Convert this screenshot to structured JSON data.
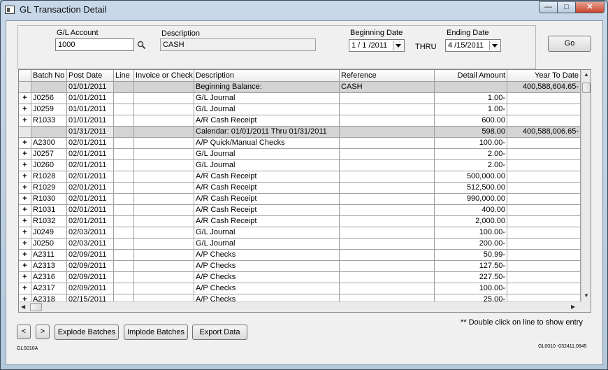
{
  "window": {
    "title": "GL Transaction Detail",
    "min_glyph": "—",
    "max_glyph": "□",
    "close_glyph": "✕"
  },
  "header": {
    "gl_account_label": "G/L Account",
    "gl_account_value": "1000",
    "description_label": "Description",
    "description_value": "CASH",
    "beginning_date_label": "Beginning Date",
    "beginning_date_value": "1 / 1 /2011",
    "thru_label": "THRU",
    "ending_date_label": "Ending Date",
    "ending_date_value": "4 /15/2011",
    "go_label": "Go"
  },
  "grid": {
    "columns": [
      "",
      "Batch No",
      "Post Date",
      "Line",
      "Invoice or Check",
      "Description",
      "Reference",
      "Detail Amount",
      "Year To Date"
    ],
    "rows": [
      {
        "expander": "",
        "batch": "",
        "post_date": "01/01/2011",
        "line": "",
        "invoice": "",
        "description": "Beginning Balance:",
        "reference": "CASH",
        "amount": "",
        "ytd": "400,588,604.65-",
        "shaded": true
      },
      {
        "expander": "+",
        "batch": "J0256",
        "post_date": "01/01/2011",
        "line": "",
        "invoice": "",
        "description": "G/L Journal",
        "reference": "",
        "amount": "1.00-",
        "ytd": "",
        "shaded": false
      },
      {
        "expander": "+",
        "batch": "J0259",
        "post_date": "01/01/2011",
        "line": "",
        "invoice": "",
        "description": "G/L Journal",
        "reference": "",
        "amount": "1.00-",
        "ytd": "",
        "shaded": false
      },
      {
        "expander": "+",
        "batch": "R1033",
        "post_date": "01/01/2011",
        "line": "",
        "invoice": "",
        "description": "A/R Cash Receipt",
        "reference": "",
        "amount": "600.00",
        "ytd": "",
        "shaded": false
      },
      {
        "expander": "",
        "batch": "",
        "post_date": "01/31/2011",
        "line": "",
        "invoice": "",
        "description": "Calendar: 01/01/2011  Thru  01/31/2011",
        "reference": "",
        "amount": "598.00",
        "ytd": "400,588,006.65-",
        "shaded": true
      },
      {
        "expander": "+",
        "batch": "A2300",
        "post_date": "02/01/2011",
        "line": "",
        "invoice": "",
        "description": "A/P Quick/Manual Checks",
        "reference": "",
        "amount": "100.00-",
        "ytd": "",
        "shaded": false
      },
      {
        "expander": "+",
        "batch": "J0257",
        "post_date": "02/01/2011",
        "line": "",
        "invoice": "",
        "description": "G/L Journal",
        "reference": "",
        "amount": "2.00-",
        "ytd": "",
        "shaded": false
      },
      {
        "expander": "+",
        "batch": "J0260",
        "post_date": "02/01/2011",
        "line": "",
        "invoice": "",
        "description": "G/L Journal",
        "reference": "",
        "amount": "2.00-",
        "ytd": "",
        "shaded": false
      },
      {
        "expander": "+",
        "batch": "R1028",
        "post_date": "02/01/2011",
        "line": "",
        "invoice": "",
        "description": "A/R Cash Receipt",
        "reference": "",
        "amount": "500,000.00",
        "ytd": "",
        "shaded": false
      },
      {
        "expander": "+",
        "batch": "R1029",
        "post_date": "02/01/2011",
        "line": "",
        "invoice": "",
        "description": "A/R Cash Receipt",
        "reference": "",
        "amount": "512,500.00",
        "ytd": "",
        "shaded": false
      },
      {
        "expander": "+",
        "batch": "R1030",
        "post_date": "02/01/2011",
        "line": "",
        "invoice": "",
        "description": "A/R Cash Receipt",
        "reference": "",
        "amount": "990,000.00",
        "ytd": "",
        "shaded": false
      },
      {
        "expander": "+",
        "batch": "R1031",
        "post_date": "02/01/2011",
        "line": "",
        "invoice": "",
        "description": "A/R Cash Receipt",
        "reference": "",
        "amount": "400.00",
        "ytd": "",
        "shaded": false
      },
      {
        "expander": "+",
        "batch": "R1032",
        "post_date": "02/01/2011",
        "line": "",
        "invoice": "",
        "description": "A/R Cash Receipt",
        "reference": "",
        "amount": "2,000.00",
        "ytd": "",
        "shaded": false
      },
      {
        "expander": "+",
        "batch": "J0249",
        "post_date": "02/03/2011",
        "line": "",
        "invoice": "",
        "description": "G/L Journal",
        "reference": "",
        "amount": "100.00-",
        "ytd": "",
        "shaded": false
      },
      {
        "expander": "+",
        "batch": "J0250",
        "post_date": "02/03/2011",
        "line": "",
        "invoice": "",
        "description": "G/L Journal",
        "reference": "",
        "amount": "200.00-",
        "ytd": "",
        "shaded": false
      },
      {
        "expander": "+",
        "batch": "A2311",
        "post_date": "02/09/2011",
        "line": "",
        "invoice": "",
        "description": "A/P Checks",
        "reference": "",
        "amount": "50.99-",
        "ytd": "",
        "shaded": false
      },
      {
        "expander": "+",
        "batch": "A2313",
        "post_date": "02/09/2011",
        "line": "",
        "invoice": "",
        "description": "A/P Checks",
        "reference": "",
        "amount": "127.50-",
        "ytd": "",
        "shaded": false
      },
      {
        "expander": "+",
        "batch": "A2316",
        "post_date": "02/09/2011",
        "line": "",
        "invoice": "",
        "description": "A/P Checks",
        "reference": "",
        "amount": "227.50-",
        "ytd": "",
        "shaded": false
      },
      {
        "expander": "+",
        "batch": "A2317",
        "post_date": "02/09/2011",
        "line": "",
        "invoice": "",
        "description": "A/P Checks",
        "reference": "",
        "amount": "100.00-",
        "ytd": "",
        "shaded": false
      },
      {
        "expander": "+",
        "batch": "A2318",
        "post_date": "02/15/2011",
        "line": "",
        "invoice": "",
        "description": "A/P Checks",
        "reference": "",
        "amount": "25.00-",
        "ytd": "",
        "shaded": false
      }
    ]
  },
  "footer": {
    "prev_label": "<",
    "next_label": ">",
    "explode_label": "Explode Batches",
    "implode_label": "Implode Batches",
    "export_label": "Export Data",
    "hint": "**  Double click on line to show entry",
    "program_id": "GLS010A",
    "version": "GL0010 -032411.0845"
  }
}
